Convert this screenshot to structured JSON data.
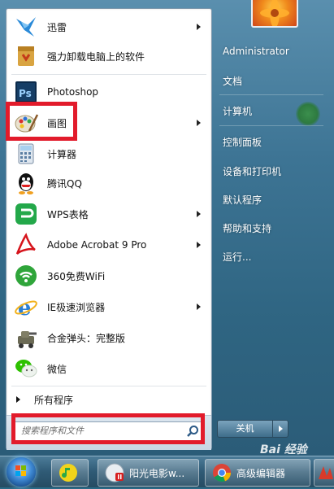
{
  "start_menu": {
    "programs": [
      {
        "label": "迅雷",
        "icon": "xunlei-icon",
        "has_submenu": true
      },
      {
        "label": "强力卸载电脑上的软件",
        "icon": "uninstall-icon",
        "has_submenu": false
      },
      {
        "label": "Photoshop",
        "icon": "photoshop-icon",
        "has_submenu": false
      },
      {
        "label": "画图",
        "icon": "paint-icon",
        "has_submenu": true
      },
      {
        "label": "计算器",
        "icon": "calculator-icon",
        "has_submenu": false
      },
      {
        "label": "腾讯QQ",
        "icon": "qq-icon",
        "has_submenu": false
      },
      {
        "label": "WPS表格",
        "icon": "wps-spreadsheet-icon",
        "has_submenu": true
      },
      {
        "label": "Adobe Acrobat 9 Pro",
        "icon": "acrobat-icon",
        "has_submenu": true
      },
      {
        "label": "360免费WiFi",
        "icon": "wifi-icon",
        "has_submenu": false
      },
      {
        "label": "IE极速浏览器",
        "icon": "ie-icon",
        "has_submenu": true
      },
      {
        "label": "合金弹头：完整版",
        "icon": "metal-slug-icon",
        "has_submenu": false
      },
      {
        "label": "微信",
        "icon": "wechat-icon",
        "has_submenu": false
      }
    ],
    "all_programs": "所有程序",
    "search": {
      "placeholder": "搜索程序和文件",
      "icon": "search-icon"
    }
  },
  "right_panel": {
    "items": [
      "Administrator",
      "文档",
      "计算机",
      "控制面板",
      "设备和打印机",
      "默认程序",
      "帮助和支持",
      "运行..."
    ],
    "shutdown_label": "关机"
  },
  "taskbar": {
    "items": [
      {
        "label": "阳光电影w...",
        "icon": "video-player-icon"
      },
      {
        "label": "高级编辑器",
        "icon": "chrome-icon"
      }
    ]
  },
  "watermark": "Bai 经验",
  "colors": {
    "highlight": "#e21b2b",
    "frame": "#3d7494"
  }
}
